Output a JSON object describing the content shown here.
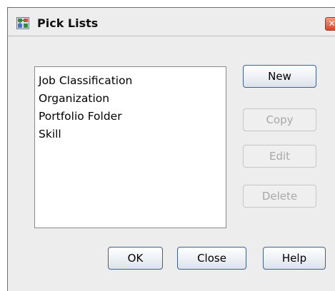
{
  "window": {
    "title": "Pick Lists",
    "close_glyph": "✕"
  },
  "list": {
    "items": [
      {
        "label": "Job Classification"
      },
      {
        "label": "Organization"
      },
      {
        "label": "Portfolio Folder"
      },
      {
        "label": "Skill"
      }
    ]
  },
  "side_buttons": {
    "new": {
      "label": "New",
      "enabled": true
    },
    "copy": {
      "label": "Copy",
      "enabled": false
    },
    "edit": {
      "label": "Edit",
      "enabled": false
    },
    "delete": {
      "label": "Delete",
      "enabled": false
    }
  },
  "footer_buttons": {
    "ok": "OK",
    "close": "Close",
    "help": "Help"
  },
  "colors": {
    "dialog_background": "#ededed",
    "button_border": "#3f5f8c",
    "disabled_text": "#a8a8a8",
    "close_button": "#d8452a"
  },
  "icons": {
    "app": "pick-lists-app-icon",
    "close": "close-icon"
  }
}
